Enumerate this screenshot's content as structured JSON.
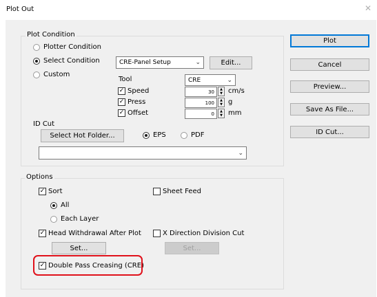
{
  "window": {
    "title": "Plot Out",
    "close_glyph": "✕"
  },
  "plot_condition": {
    "group_label": "Plot Condition",
    "radio_plotter": "Plotter Condition",
    "radio_select": "Select Condition",
    "radio_custom": "Custom",
    "selected": "Select Condition",
    "condition_select": "CRE-Panel Setup",
    "edit_button": "Edit...",
    "tool_label": "Tool",
    "tool_select": "CRE",
    "speed": {
      "label": "Speed",
      "checked": true,
      "value": "30",
      "unit": "cm/s"
    },
    "press": {
      "label": "Press",
      "checked": true,
      "value": "100",
      "unit": "g"
    },
    "offset": {
      "label": "Offset",
      "checked": true,
      "value": "0",
      "unit": "mm"
    }
  },
  "id_cut": {
    "label": "ID Cut",
    "select_hot_folder_button": "Select Hot Folder...",
    "radio_eps": "EPS",
    "radio_pdf": "PDF",
    "selected": "EPS",
    "folder_path": ""
  },
  "options": {
    "group_label": "Options",
    "sort": {
      "label": "Sort",
      "checked": true
    },
    "radio_all": "All",
    "radio_each_layer": "Each Layer",
    "sort_selected": "All",
    "sheet_feed": {
      "label": "Sheet Feed",
      "checked": false
    },
    "head_withdrawal": {
      "label": "Head Withdrawal After Plot",
      "checked": true
    },
    "head_set_button": "Set...",
    "x_direction": {
      "label": "X Direction Division Cut",
      "checked": false
    },
    "x_set_button": "Set...",
    "double_pass": {
      "label": "Double Pass Creasing (CRE)",
      "checked": true
    }
  },
  "actions": {
    "plot": "Plot",
    "cancel": "Cancel",
    "preview": "Preview...",
    "save_as_file": "Save As File...",
    "id_cut": "ID Cut..."
  },
  "colors": {
    "highlight": "#e0101a",
    "focus": "#0078d7",
    "dialog_bg": "#f0f0f0"
  }
}
